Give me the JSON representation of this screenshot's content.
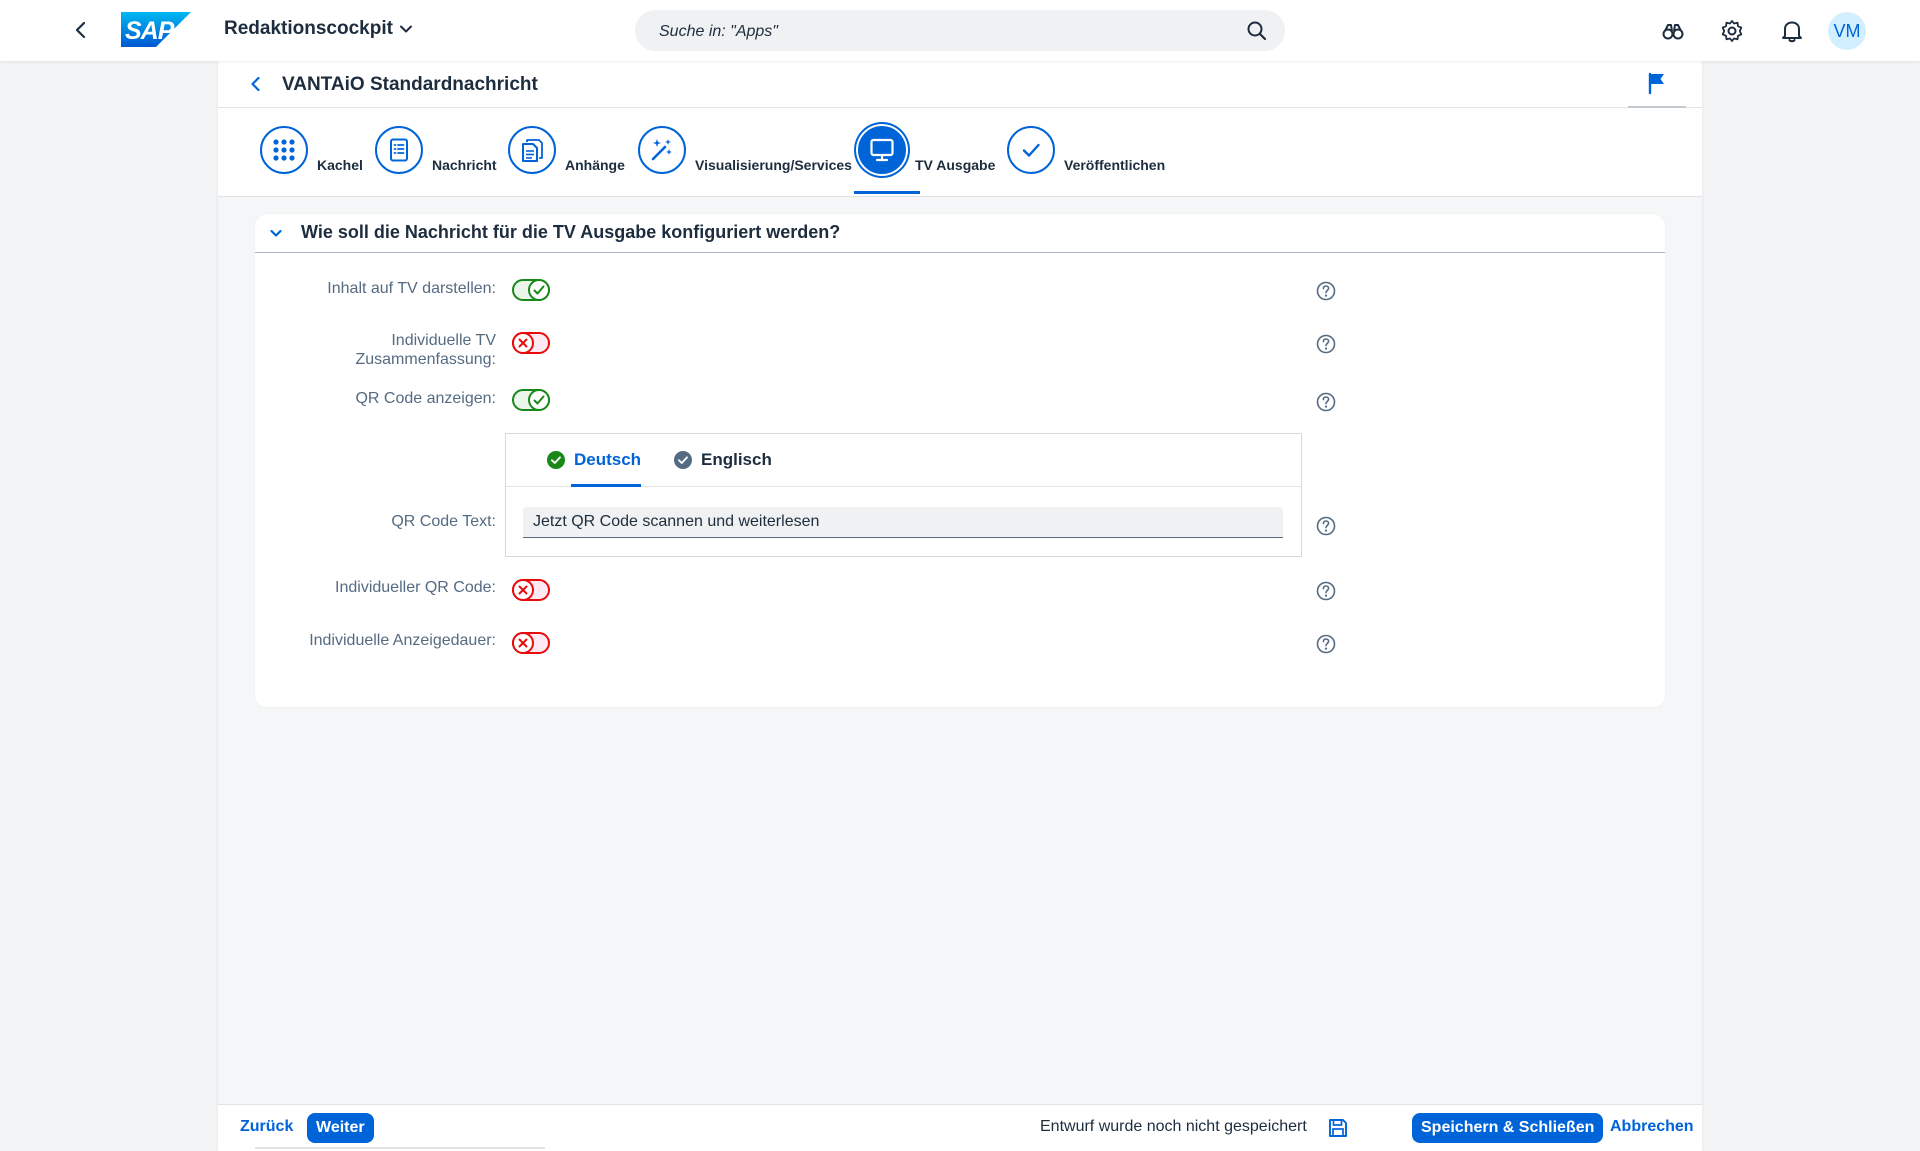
{
  "shell": {
    "app_title": "Redaktionscockpit",
    "search_placeholder": "Suche in: \"Apps\"",
    "avatar_initials": "VM",
    "brand_logo": "SAP",
    "brand_color": "#0064d9"
  },
  "page": {
    "title": "VANTAiO Standardnachricht"
  },
  "wizard": {
    "steps": [
      {
        "label": "Kachel",
        "icon": "grid-icon"
      },
      {
        "label": "Nachricht",
        "icon": "document-list-icon"
      },
      {
        "label": "Anhänge",
        "icon": "attachment-docs-icon"
      },
      {
        "label": "Visualisierung/Services",
        "icon": "magic-wand-icon"
      },
      {
        "label": "TV Ausgabe",
        "icon": "monitor-icon",
        "active": true
      },
      {
        "label": "Veröffentlichen",
        "icon": "checkmark-icon"
      }
    ]
  },
  "section": {
    "title": "Wie soll die Nachricht für die TV Ausgabe konfiguriert werden?",
    "fields": {
      "inhalt_tv": {
        "label": "Inhalt auf TV darstellen:",
        "value": true
      },
      "indiv_tv_summary": {
        "label_line1": "Individuelle TV",
        "label_line2": "Zusammenfassung:",
        "value": false
      },
      "qr_anzeigen": {
        "label": "QR Code anzeigen:",
        "value": true
      },
      "qr_text": {
        "label": "QR Code Text:",
        "value": "Jetzt QR Code scannen und weiterlesen"
      },
      "indiv_qr": {
        "label": "Individueller QR Code:",
        "value": false
      },
      "indiv_dauer": {
        "label": "Individuelle Anzeigedauer:",
        "value": false
      }
    },
    "language_tabs": [
      {
        "label": "Deutsch",
        "status": "complete",
        "selected": true
      },
      {
        "label": "Englisch",
        "status": "complete",
        "selected": false
      }
    ]
  },
  "footer": {
    "back": "Zurück",
    "next": "Weiter",
    "draft_status": "Entwurf wurde noch nicht gespeichert",
    "save_close": "Speichern & Schließen",
    "cancel": "Abbrechen"
  },
  "colors": {
    "positive": "#188918",
    "negative": "#e90b0b",
    "accent": "#0064d9"
  }
}
